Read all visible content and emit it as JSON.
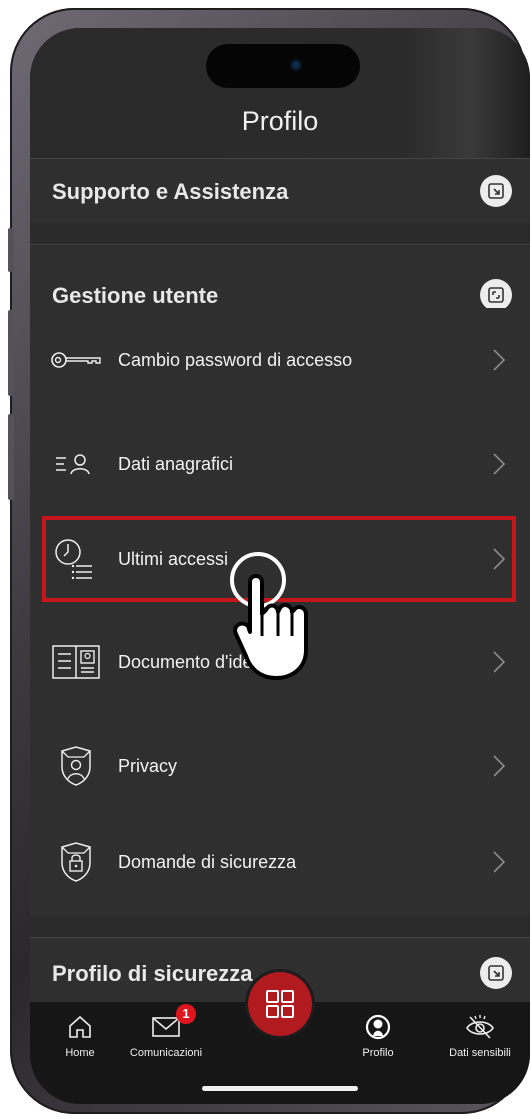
{
  "header": {
    "title": "Profilo"
  },
  "sections": {
    "support": {
      "title": "Supporto e Assistenza",
      "icon": "external-link-icon"
    },
    "user_management": {
      "title": "Gestione utente",
      "icon": "collapse-icon"
    },
    "security_profile": {
      "title": "Profilo di sicurezza",
      "icon": "external-link-icon"
    }
  },
  "menu": {
    "items": [
      {
        "label": "Cambio password di accesso",
        "icon": "key-icon"
      },
      {
        "label": "Dati anagrafici",
        "icon": "user-list-icon"
      },
      {
        "label": "Ultimi accessi",
        "icon": "clock-list-icon",
        "highlighted": true
      },
      {
        "label": "Documento d'identità",
        "icon": "id-card-icon"
      },
      {
        "label": "Privacy",
        "icon": "shield-user-icon"
      },
      {
        "label": "Domande di sicurezza",
        "icon": "shield-lock-icon"
      }
    ]
  },
  "nav": {
    "items": [
      {
        "label": "Home",
        "icon": "home-icon"
      },
      {
        "label": "Comunicazioni",
        "icon": "mail-icon",
        "badge": "1"
      },
      {
        "label": "",
        "icon": "grid-icon",
        "center": true
      },
      {
        "label": "Profilo",
        "icon": "profile-icon",
        "active": true
      },
      {
        "label": "Dati sensibili",
        "icon": "eye-slash-icon"
      }
    ]
  },
  "colors": {
    "accent": "#c6161c",
    "background": "#262626",
    "section_bg": "#2f2f2f",
    "text": "#f2f2f2"
  }
}
